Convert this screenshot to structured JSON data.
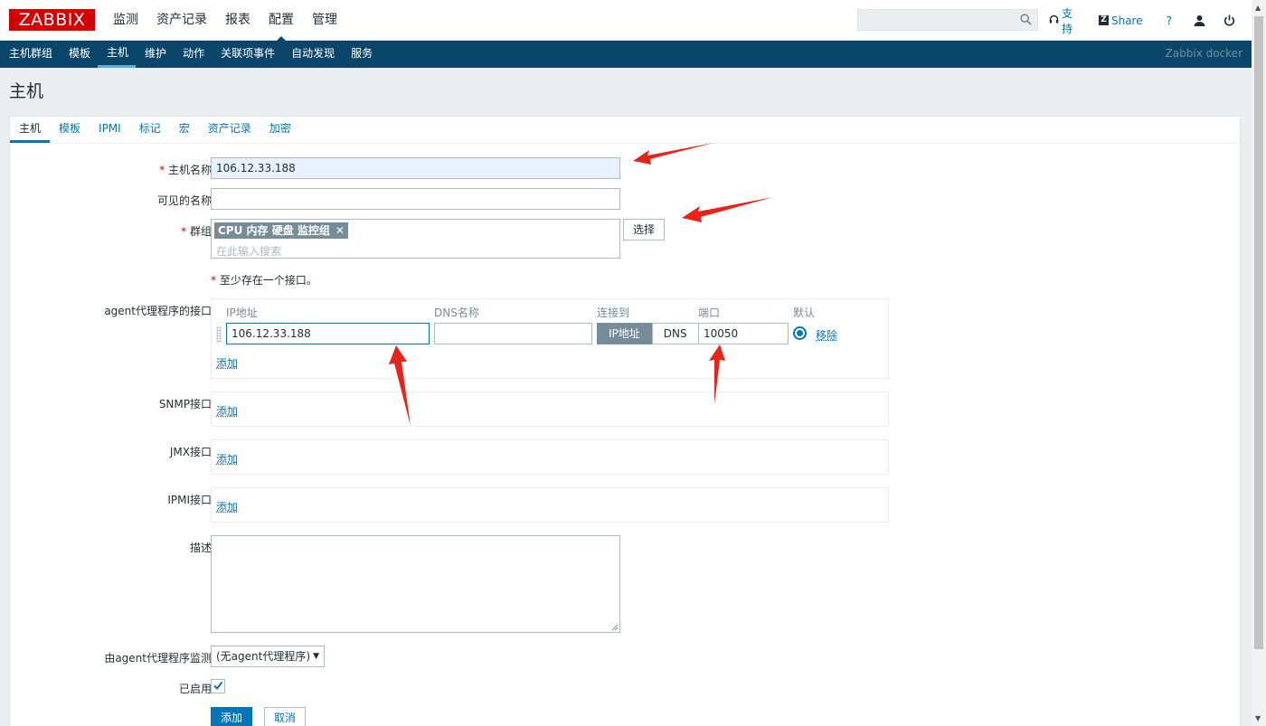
{
  "logo": "ZABBIX",
  "main_menu": [
    "监测",
    "资产记录",
    "报表",
    "配置",
    "管理"
  ],
  "main_menu_active": 3,
  "top_tools": {
    "support": "支持",
    "share": "Share",
    "help": "?"
  },
  "sub_menu": [
    "主机群组",
    "模板",
    "主机",
    "维护",
    "动作",
    "关联项事件",
    "自动发现",
    "服务"
  ],
  "sub_menu_right": "Zabbix docker",
  "page_title": "主机",
  "tabs": [
    "主机",
    "模板",
    "IPMI",
    "标记",
    "宏",
    "资产记录",
    "加密"
  ],
  "form": {
    "host_name_label": "主机名称",
    "host_name_value": "106.12.33.188",
    "visible_name_label": "可见的名称",
    "visible_name_value": "",
    "groups_label": "群组",
    "group_tag": "CPU 内存 硬盘 监控组",
    "group_placeholder": "在此输入搜索",
    "select_button": "选择",
    "interface_note": "至少存在一个接口。",
    "agent_label": "agent代理程序的接口",
    "iface_headers": {
      "ip": "IP地址",
      "dns": "DNS名称",
      "connect": "连接到",
      "port": "端口",
      "default": "默认"
    },
    "iface_ip": "106.12.33.188",
    "iface_dns": "",
    "connect_ip": "IP地址",
    "connect_dns": "DNS",
    "iface_port": "10050",
    "remove_link": "移除",
    "add_link": "添加",
    "snmp_label": "SNMP接口",
    "jmx_label": "JMX接口",
    "ipmi_label": "IPMI接口",
    "description_label": "描述",
    "proxy_label": "由agent代理程序监测",
    "proxy_value": "(无agent代理程序)",
    "enabled_label": "已启用",
    "enabled": true,
    "submit_button": "添加",
    "cancel_button": "取消"
  },
  "colors": {
    "brand": "#d40000",
    "nav": "#0a466a",
    "link": "#0275b8",
    "annotation_arrow": "#e8231c"
  }
}
